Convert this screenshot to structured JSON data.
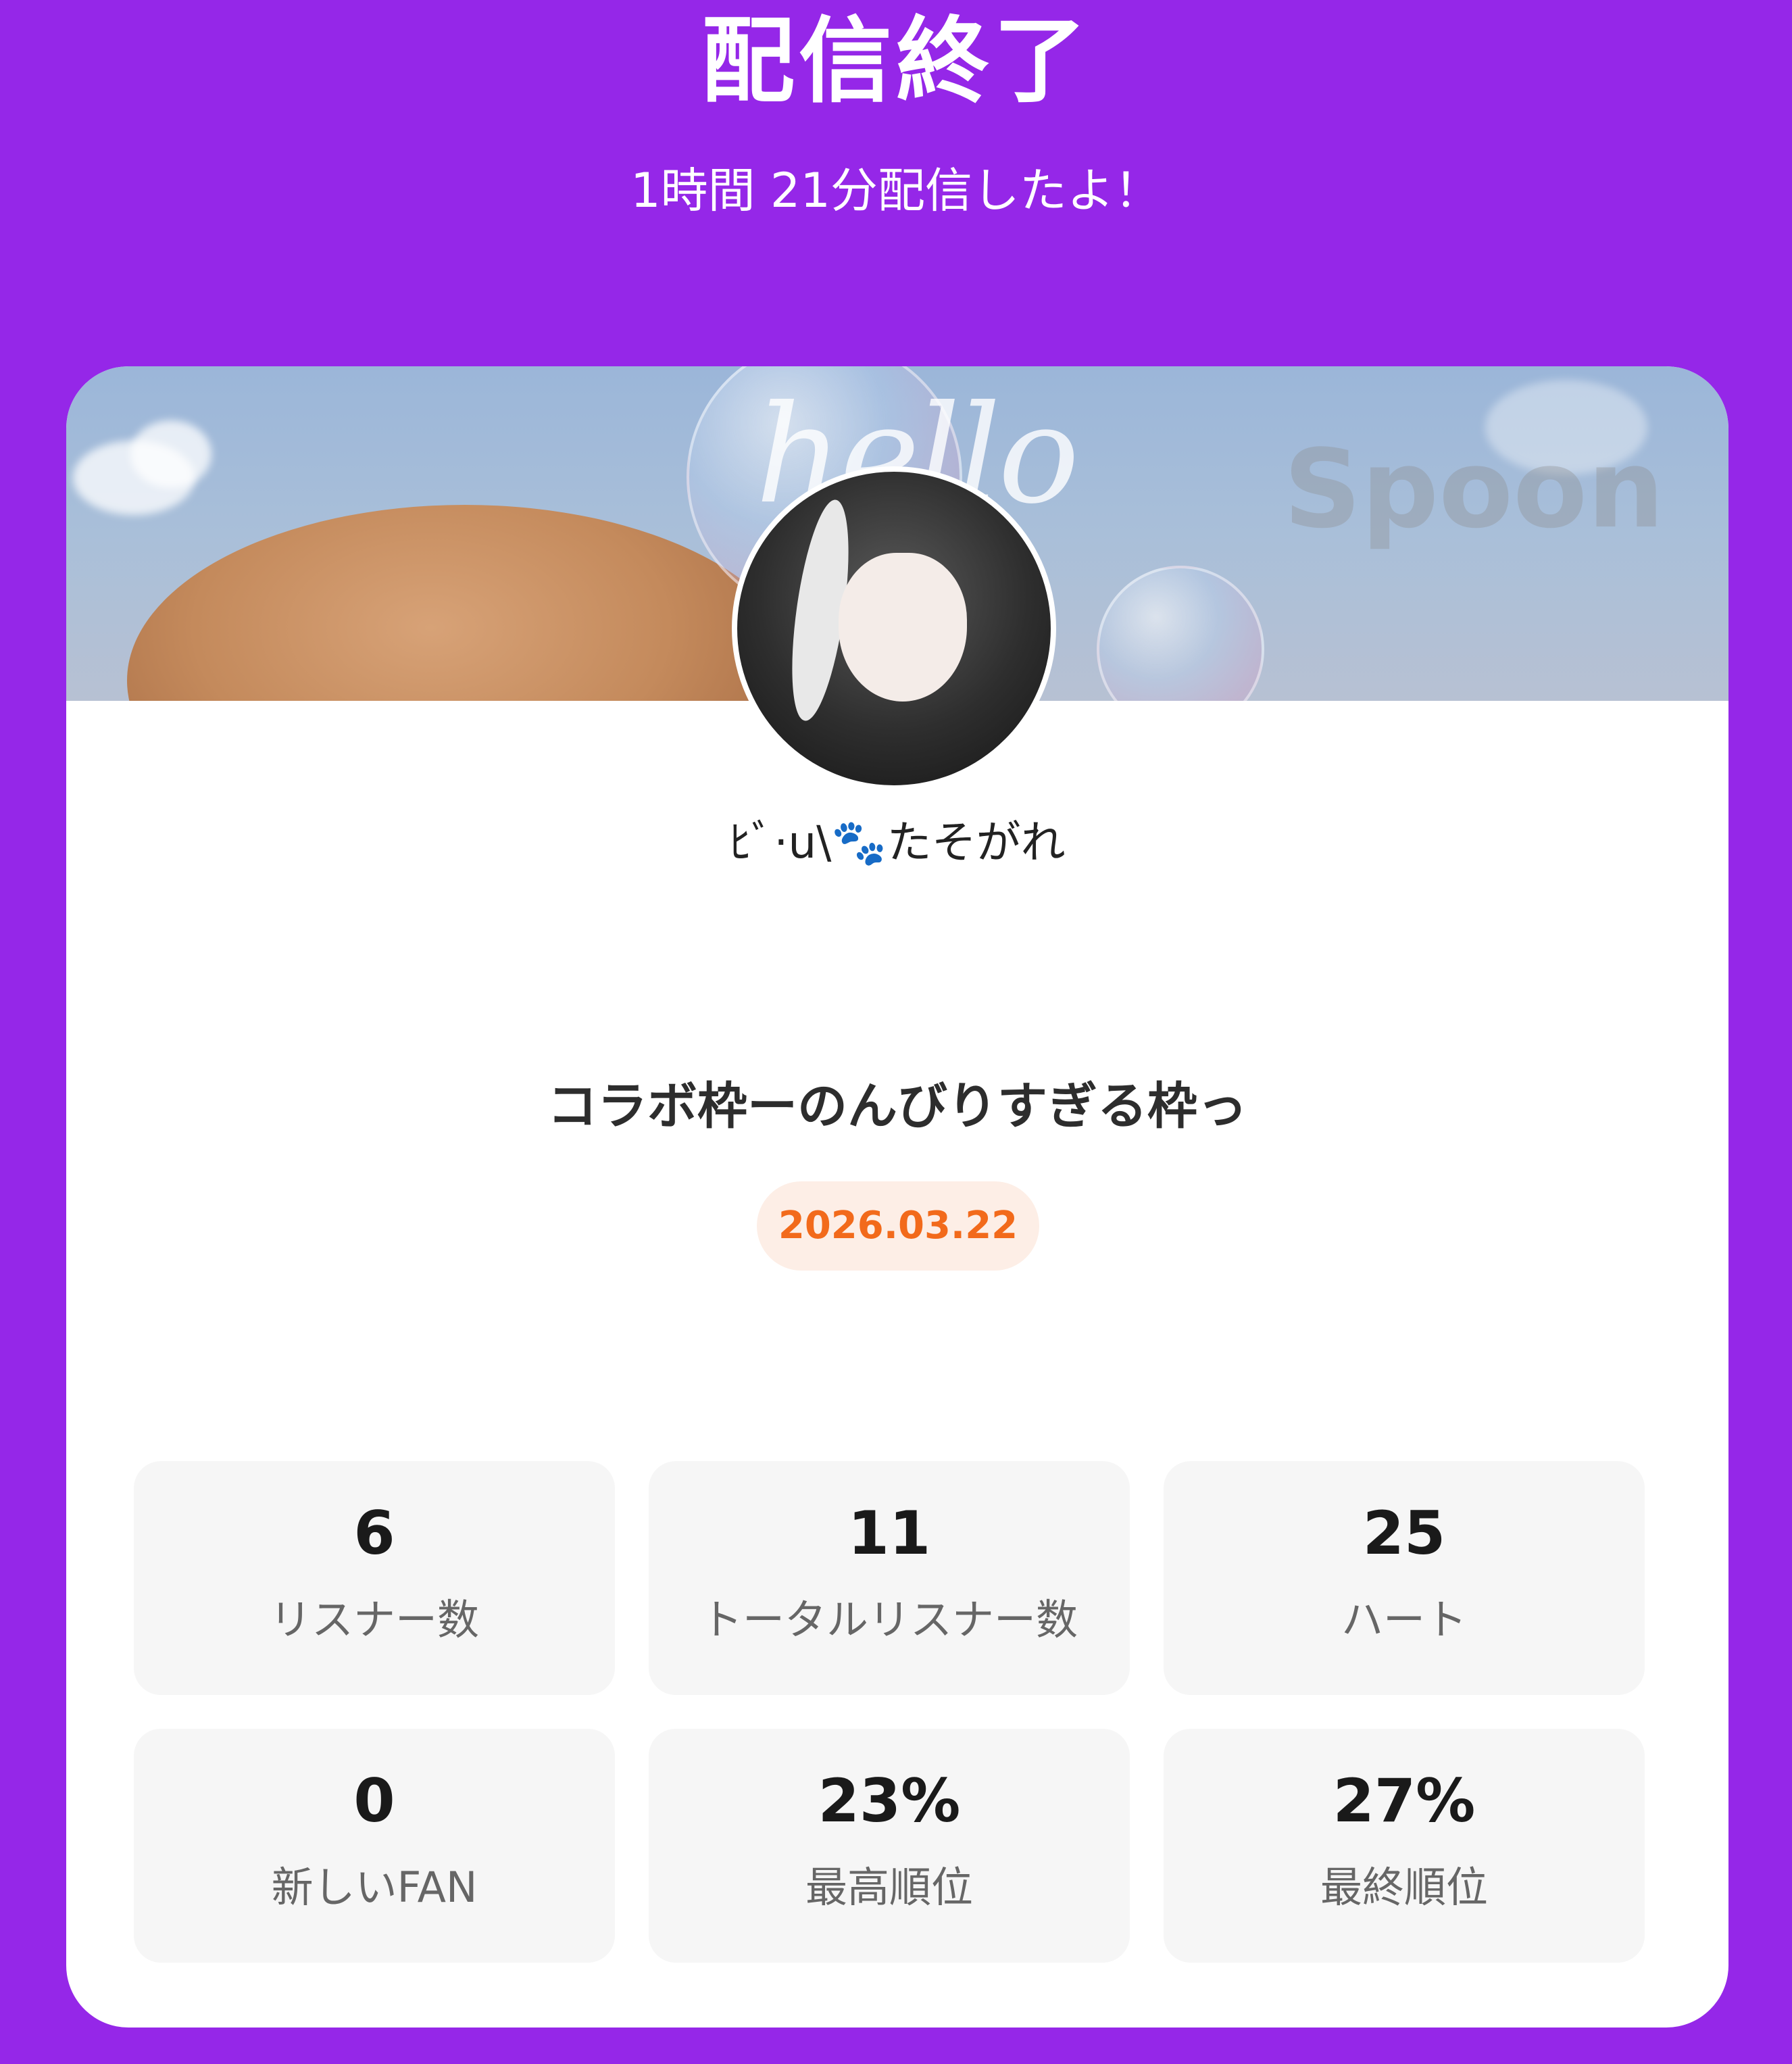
{
  "header": {
    "title": "配信終了",
    "subtitle": "1時間 21分配信したよ！"
  },
  "card": {
    "banner": {
      "hello_text": "hello",
      "watermark": "Spoon"
    },
    "username": "ﾋﾞ·u\\🐾たそがれ",
    "show_title": "コラボ枠ーのんびりすぎる枠っ",
    "date": "2026.03.22",
    "date_colors": {
      "text": "#f26a1b",
      "background": "#fdeee6"
    }
  },
  "stats": [
    {
      "value": "6",
      "label": "リスナー数"
    },
    {
      "value": "11",
      "label": "トータルリスナー数"
    },
    {
      "value": "25",
      "label": "ハート"
    },
    {
      "value": "0",
      "label": "新しいFAN"
    },
    {
      "value": "23%",
      "label": "最高順位"
    },
    {
      "value": "27%",
      "label": "最終順位"
    }
  ],
  "colors": {
    "background": "#9527e8",
    "card": "#ffffff",
    "stat_box": "#f6f6f6"
  }
}
